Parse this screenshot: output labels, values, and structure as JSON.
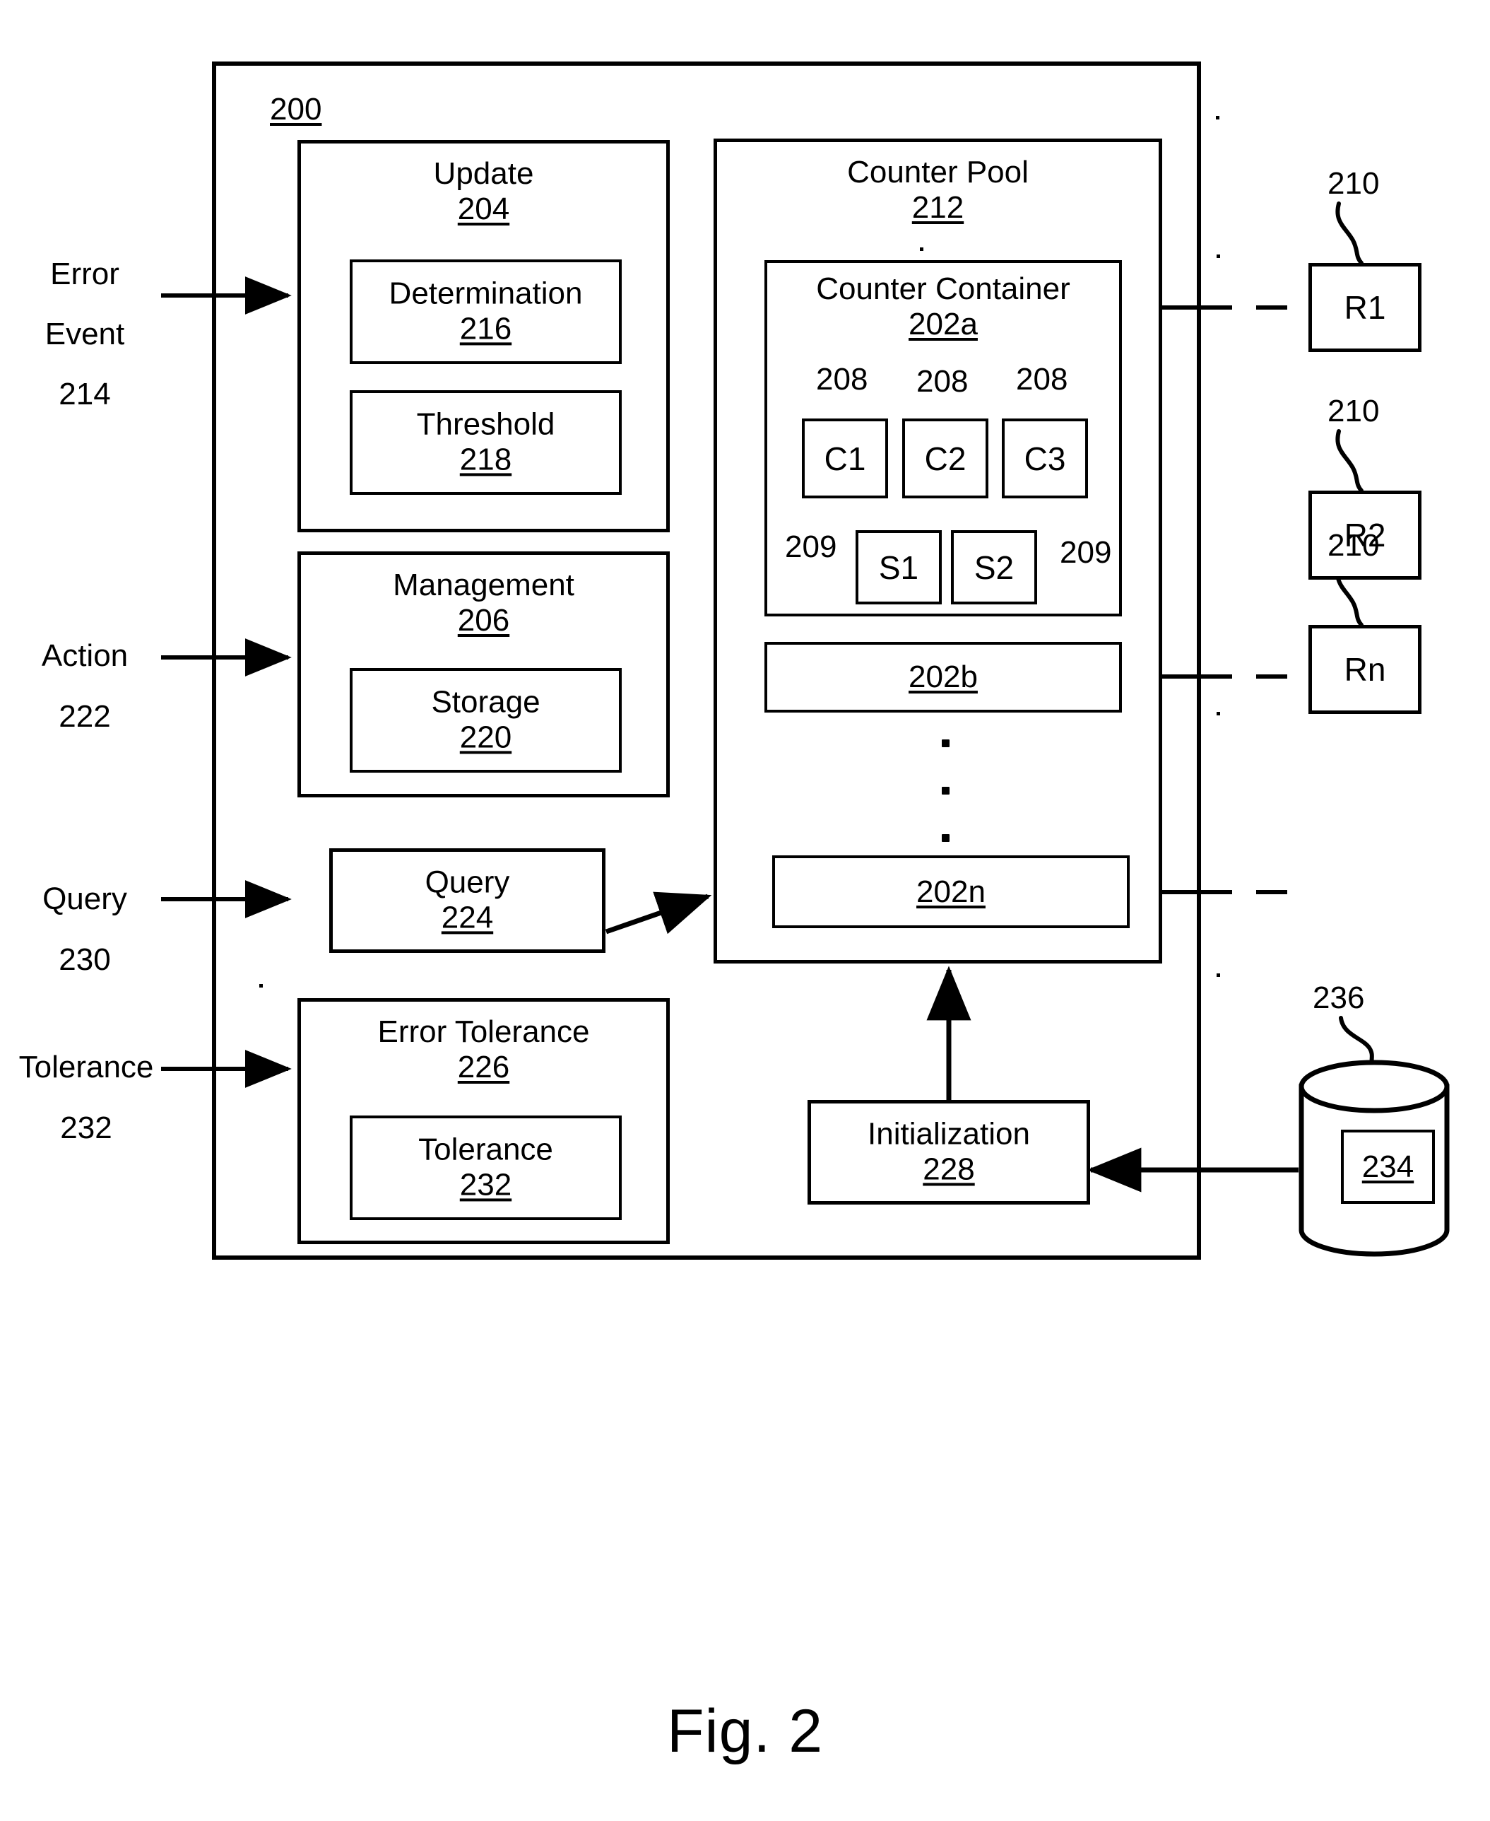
{
  "figure": {
    "caption": "Fig. 2",
    "system_ref": "200"
  },
  "inputs": [
    {
      "id": "error-event",
      "line1": "Error",
      "line2": "Event",
      "ref": "214"
    },
    {
      "id": "action",
      "line1": "Action",
      "line2": "",
      "ref": "222"
    },
    {
      "id": "query",
      "line1": "Query",
      "line2": "",
      "ref": "230"
    },
    {
      "id": "tolerance",
      "line1": "Tolerance",
      "line2": "",
      "ref": "232"
    }
  ],
  "modules": {
    "update": {
      "title": "Update",
      "ref": "204"
    },
    "determination": {
      "title": "Determination",
      "ref": "216"
    },
    "threshold": {
      "title": "Threshold",
      "ref": "218"
    },
    "management": {
      "title": "Management",
      "ref": "206"
    },
    "storage": {
      "title": "Storage",
      "ref": "220"
    },
    "query": {
      "title": "Query",
      "ref": "224"
    },
    "error_tolerance": {
      "title": "Error Tolerance",
      "ref": "226"
    },
    "tolerance": {
      "title": "Tolerance",
      "ref": "232"
    },
    "initialization": {
      "title": "Initialization",
      "ref": "228"
    }
  },
  "counter_pool": {
    "title": "Counter Pool",
    "ref": "212",
    "containers": [
      {
        "title": "Counter Container",
        "ref": "202a"
      },
      {
        "title": "",
        "ref": "202b"
      },
      {
        "title": "",
        "ref": "202n"
      }
    ],
    "counters": [
      {
        "label": "C1",
        "ref": "208"
      },
      {
        "label": "C2",
        "ref": "208"
      },
      {
        "label": "C3",
        "ref": "208"
      }
    ],
    "subcounters": [
      {
        "label": "S1",
        "ref": "209"
      },
      {
        "label": "S2",
        "ref": "209"
      }
    ],
    "ellipsis": "•"
  },
  "resources": [
    {
      "label": "R1",
      "ref": "210"
    },
    {
      "label": "R2",
      "ref": "210"
    },
    {
      "label": "Rn",
      "ref": "210"
    }
  ],
  "datastore": {
    "inner_ref": "234",
    "outer_ref": "236"
  },
  "colors": {
    "ink": "#000000",
    "paper": "#ffffff"
  }
}
